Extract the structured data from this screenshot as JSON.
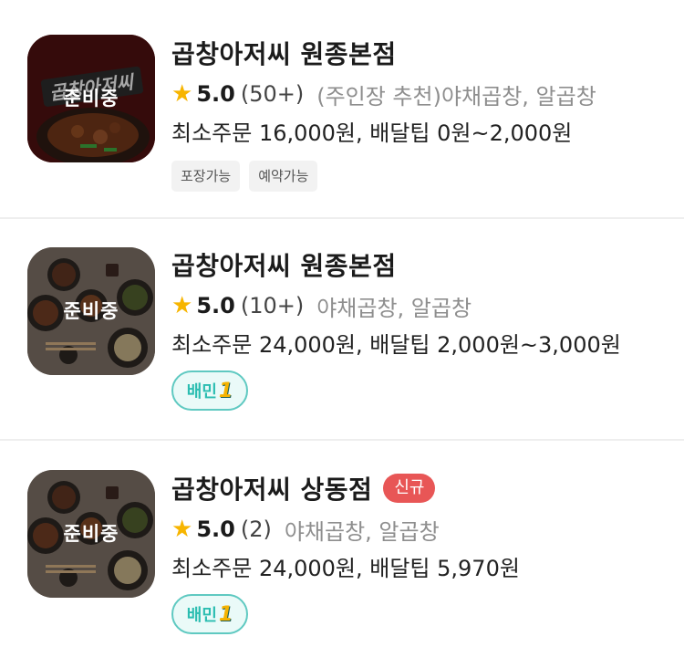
{
  "restaurants": [
    {
      "name": "곱창아저씨 원종본점",
      "status_overlay": "준비중",
      "thumb_logo_text": "곱창아저씨",
      "rating": "5.0",
      "review_count": "(50+)",
      "categories": "(주인장 추천)야채곱창, 알곱창",
      "order_info": "최소주문 16,000원, 배달팁 0원~2,000원",
      "tags": [
        "포장가능",
        "예약가능"
      ]
    },
    {
      "name": "곱창아저씨 원종본점",
      "status_overlay": "준비중",
      "rating": "5.0",
      "review_count": "(10+)",
      "categories": "야채곱창, 알곱창",
      "order_info": "최소주문 24,000원, 배달팁 2,000원~3,000원",
      "badge_text": "배민",
      "badge_number": "1"
    },
    {
      "name": "곱창아저씨 상동점",
      "new_badge": "신규",
      "status_overlay": "준비중",
      "rating": "5.0",
      "review_count": "(2)",
      "categories": "야채곱창, 알곱창",
      "order_info": "최소주문 24,000원, 배달팁 5,970원",
      "badge_text": "배민",
      "badge_number": "1"
    }
  ],
  "icons": {
    "rating": "star-icon"
  },
  "colors": {
    "star": "#f7b500",
    "new_badge": "#e85656",
    "baemin_border": "#5fc9c1"
  }
}
